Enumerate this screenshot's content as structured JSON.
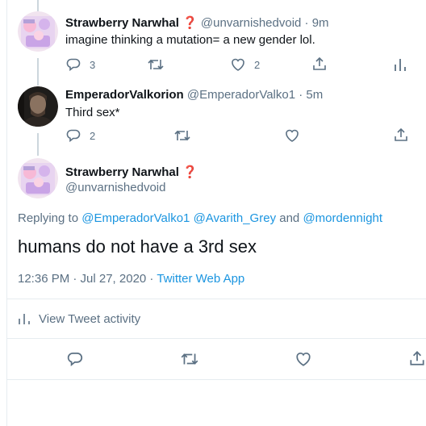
{
  "colors": {
    "accent": "#1b95e0",
    "muted": "#5b7083",
    "text": "#0f1419",
    "border": "#e6ecf0"
  },
  "tweet1": {
    "name": "Strawberry Narwhal ❓",
    "handle": "@unvarnishedvoid · 9m",
    "text": "imagine thinking a mutation= a new gender lol.",
    "replies": "3",
    "likes": "2",
    "icons": [
      "reply-icon",
      "retweet-icon",
      "like-icon",
      "share-icon",
      "analytics-icon"
    ]
  },
  "tweet2": {
    "name": "EmperadorValkorion",
    "handle": "@EmperadorValko1 · 5m",
    "text": "Third sex*",
    "replies": "2",
    "icons": [
      "reply-icon",
      "retweet-icon",
      "like-icon",
      "share-icon"
    ]
  },
  "main_tweet": {
    "name": "Strawberry Narwhal ❓",
    "handle": "@unvarnishedvoid",
    "replying_prefix": "Replying to ",
    "reply_to_1": "@EmperadorValko1",
    "reply_to_2": "@Avarith_Grey",
    "reply_and": " and ",
    "reply_to_3": "@mordennight",
    "text": "humans do not have a 3rd sex",
    "time": "12:36 PM · Jul 27, 2020 · ",
    "source": "Twitter Web App",
    "activity_label": "View Tweet activity",
    "icons": [
      "reply-icon",
      "retweet-icon",
      "like-icon",
      "share-icon"
    ]
  }
}
